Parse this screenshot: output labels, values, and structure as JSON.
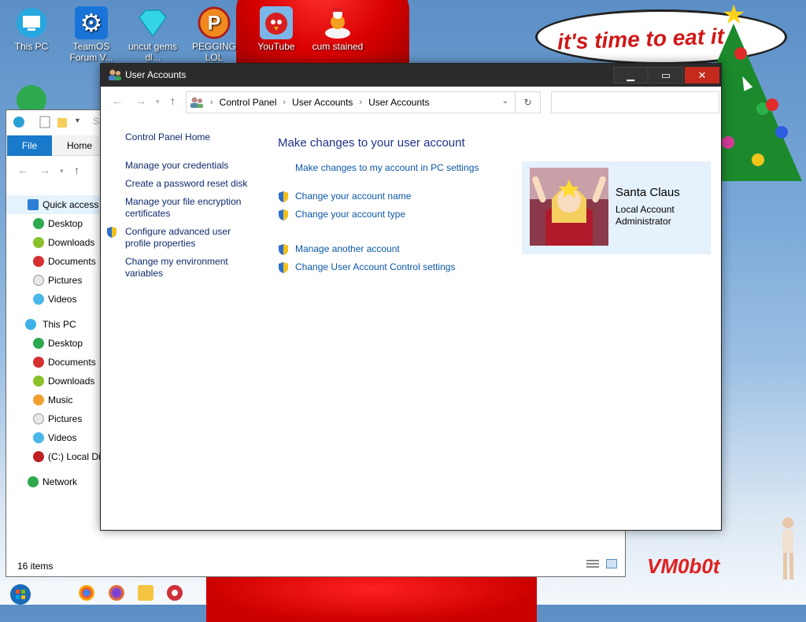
{
  "wallpaper": {
    "speech_text": "it's time to eat it",
    "logo_text": "VM0b0t"
  },
  "desktop_icons": [
    {
      "label": "This PC",
      "icon": "this-pc-icon"
    },
    {
      "label": "TeamOS Forum V...",
      "icon": "gear-icon"
    },
    {
      "label": "uncut gems dl...",
      "icon": "diamond-icon"
    },
    {
      "label": "PEGGING LOL",
      "icon": "peggle-icon"
    },
    {
      "label": "YouTube",
      "icon": "angry-bird-icon"
    },
    {
      "label": "cum stained",
      "icon": "snowman-icon"
    }
  ],
  "explorer": {
    "file_tab": "File",
    "home_tab": "Home",
    "title_fragment": "Sa",
    "tree": [
      {
        "label": "Quick access",
        "level": 1,
        "selected": true,
        "icon": "star-icon"
      },
      {
        "label": "Desktop",
        "level": 2,
        "icon": "desktop-icon"
      },
      {
        "label": "Downloads",
        "level": 2,
        "icon": "downloads-icon"
      },
      {
        "label": "Documents",
        "level": 2,
        "icon": "documents-icon"
      },
      {
        "label": "Pictures",
        "level": 2,
        "icon": "pictures-icon"
      },
      {
        "label": "Videos",
        "level": 2,
        "icon": "videos-icon"
      },
      {
        "label": "This PC",
        "level": 1,
        "icon": "this-pc-icon"
      },
      {
        "label": "Desktop",
        "level": 2,
        "icon": "desktop-icon"
      },
      {
        "label": "Documents",
        "level": 2,
        "icon": "documents-icon"
      },
      {
        "label": "Downloads",
        "level": 2,
        "icon": "downloads-icon"
      },
      {
        "label": "Music",
        "level": 2,
        "icon": "music-icon"
      },
      {
        "label": "Pictures",
        "level": 2,
        "icon": "pictures-icon"
      },
      {
        "label": "Videos",
        "level": 2,
        "icon": "videos-icon"
      },
      {
        "label": "(C:) Local Di",
        "level": 2,
        "icon": "drive-icon"
      },
      {
        "label": "Network",
        "level": 1,
        "icon": "network-icon"
      }
    ],
    "status": "16 items"
  },
  "window": {
    "title": "User Accounts",
    "breadcrumb": [
      "Control Panel",
      "User Accounts",
      "User Accounts"
    ],
    "search_placeholder": ""
  },
  "sidebar": {
    "home": "Control Panel Home",
    "links": [
      {
        "label": "Manage your credentials",
        "shield": false
      },
      {
        "label": "Create a password reset disk",
        "shield": false
      },
      {
        "label": "Manage your file encryption certificates",
        "shield": false
      },
      {
        "label": "Configure advanced user profile properties",
        "shield": true
      },
      {
        "label": "Change my environment variables",
        "shield": false
      }
    ]
  },
  "main": {
    "heading": "Make changes to your user account",
    "pc_settings_link": "Make changes to my account in PC settings",
    "links_group1": [
      {
        "label": "Change your account name",
        "shield": true
      },
      {
        "label": "Change your account type",
        "shield": true
      }
    ],
    "links_group2": [
      {
        "label": "Manage another account",
        "shield": true
      },
      {
        "label": "Change User Account Control settings",
        "shield": true
      }
    ]
  },
  "user": {
    "name": "Santa Claus",
    "type": "Local Account",
    "role": "Administrator"
  },
  "colors": {
    "link": "#0c57a6",
    "heading": "#1e3287",
    "card_bg": "#e5f1fb",
    "file_tab": "#1979ca"
  }
}
